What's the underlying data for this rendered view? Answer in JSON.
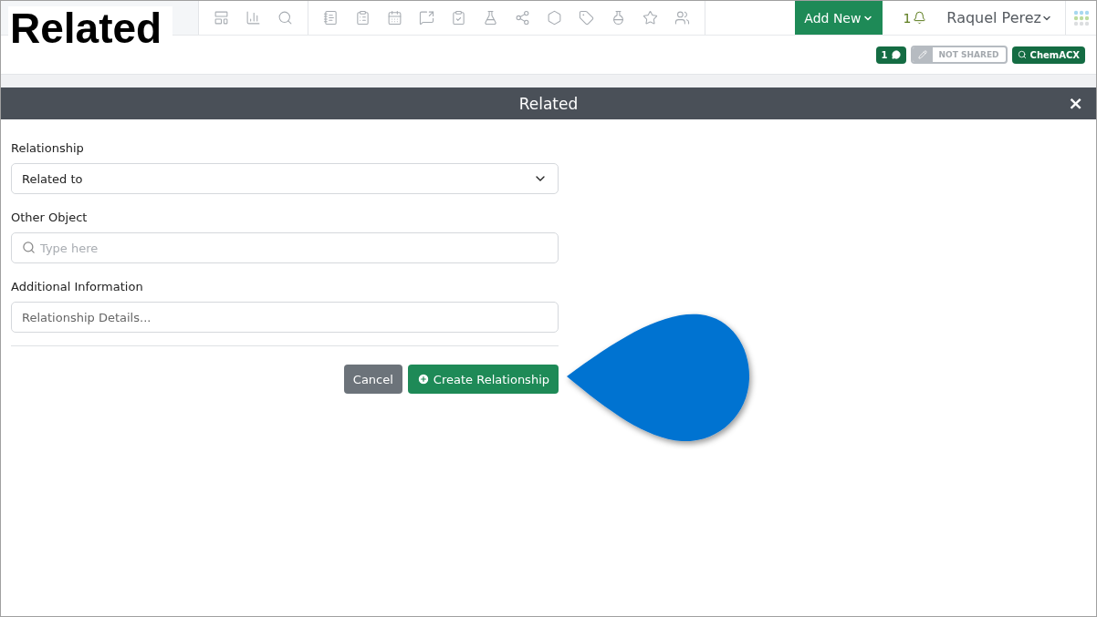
{
  "overlay_label": "Related",
  "top_bar": {
    "add_new": "Add New",
    "notification_count": "1",
    "user_name": "Raquel Perez"
  },
  "badges": {
    "comments": "1",
    "sharing": "NOT SHARED",
    "search": "ChemACX"
  },
  "dialog": {
    "title": "Related",
    "close": "×",
    "fields": [
      {
        "kind": "select",
        "label": "Relationship",
        "value": "Related to"
      },
      {
        "kind": "search",
        "label": "Other Object",
        "placeholder": "Type here"
      },
      {
        "kind": "text",
        "label": "Additional Information",
        "placeholder": "Relationship Details..."
      }
    ],
    "buttons": [
      {
        "kind": "secondary",
        "label": "Cancel"
      },
      {
        "kind": "primary",
        "label": "Create Relationship"
      }
    ]
  }
}
